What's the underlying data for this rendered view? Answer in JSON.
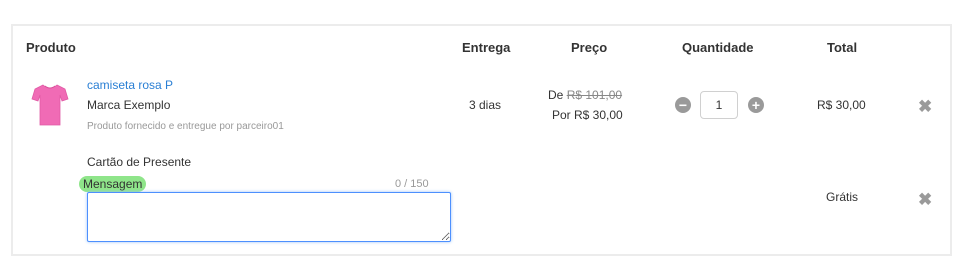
{
  "table": {
    "headers": {
      "product": "Produto",
      "delivery": "Entrega",
      "price": "Preço",
      "quantity": "Quantidade",
      "total": "Total"
    }
  },
  "item": {
    "name": "camiseta rosa P",
    "brand": "Marca Exemplo",
    "seller": "Produto fornecido e entregue por parceiro01",
    "delivery": "3 dias",
    "price_from_label": "De",
    "price_from": "R$ 101,00",
    "price_to": "Por R$ 30,00",
    "quantity": "1",
    "total": "R$ 30,00",
    "image_icon": "pink-tshirt-icon",
    "image_color": "#f06bb5"
  },
  "gift": {
    "title": "Cartão de Presente",
    "message_label": "Mensagem",
    "counter": "0 / 150",
    "message_value": "",
    "total": "Grátis"
  },
  "colors": {
    "link": "#2a7fd4",
    "highlight": "#8fe58a",
    "focus_border": "#4d90fe"
  }
}
